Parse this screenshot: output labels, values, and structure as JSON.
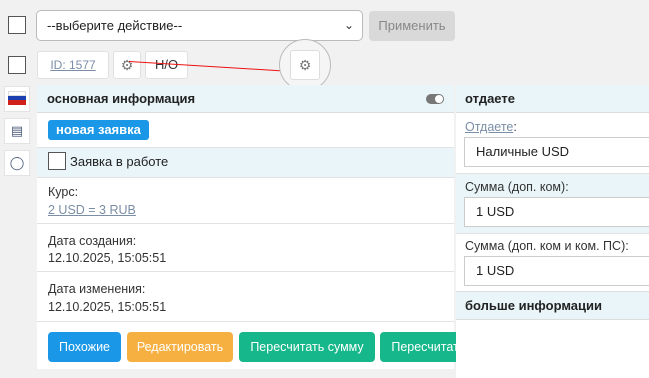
{
  "toolbar": {
    "select_value": "--выберите действие--",
    "apply_label": "Применить"
  },
  "record": {
    "id_label": "ID: 1577",
    "ho_label": "Н/О"
  },
  "sidebar": {
    "flag_colors": [
      "#ffffff",
      "#1c3fb0",
      "#d0201c"
    ],
    "icons": [
      "flag-icon",
      "comment-icon",
      "chat-icon"
    ]
  },
  "main_panel": {
    "title": "основная информация",
    "status_badge": "новая заявка",
    "in_work_label": "Заявка в работе",
    "rate_label": "Курс:",
    "rate_value": "2 USD = 3 RUB",
    "created_label": "Дата создания:",
    "created_value": "12.10.2025, 15:05:51",
    "modified_label": "Дата изменения:",
    "modified_value": "12.10.2025, 15:05:51",
    "buttons": {
      "similar": "Похожие",
      "edit": "Редактировать",
      "recalc_sum": "Пересчитать сумму",
      "recalc_rate": "Пересчитать курс"
    }
  },
  "give_panel": {
    "title": "отдаете",
    "give_link": "Отдаете",
    "give_colon": ":",
    "give_value": "Наличные USD",
    "sum_label": "Сумма (доп. ком):",
    "sum_value": "1 USD",
    "sum_ps_label": "Сумма (доп. ком и ком. ПС):",
    "sum_ps_value": "1 USD",
    "more_title": "больше информации"
  },
  "colors": {
    "accent_blue": "#1a97e6",
    "edit_orange": "#f5b041",
    "green": "#16b78a",
    "highlight": "#e9f5f9",
    "annotation_red": "#e11111"
  }
}
